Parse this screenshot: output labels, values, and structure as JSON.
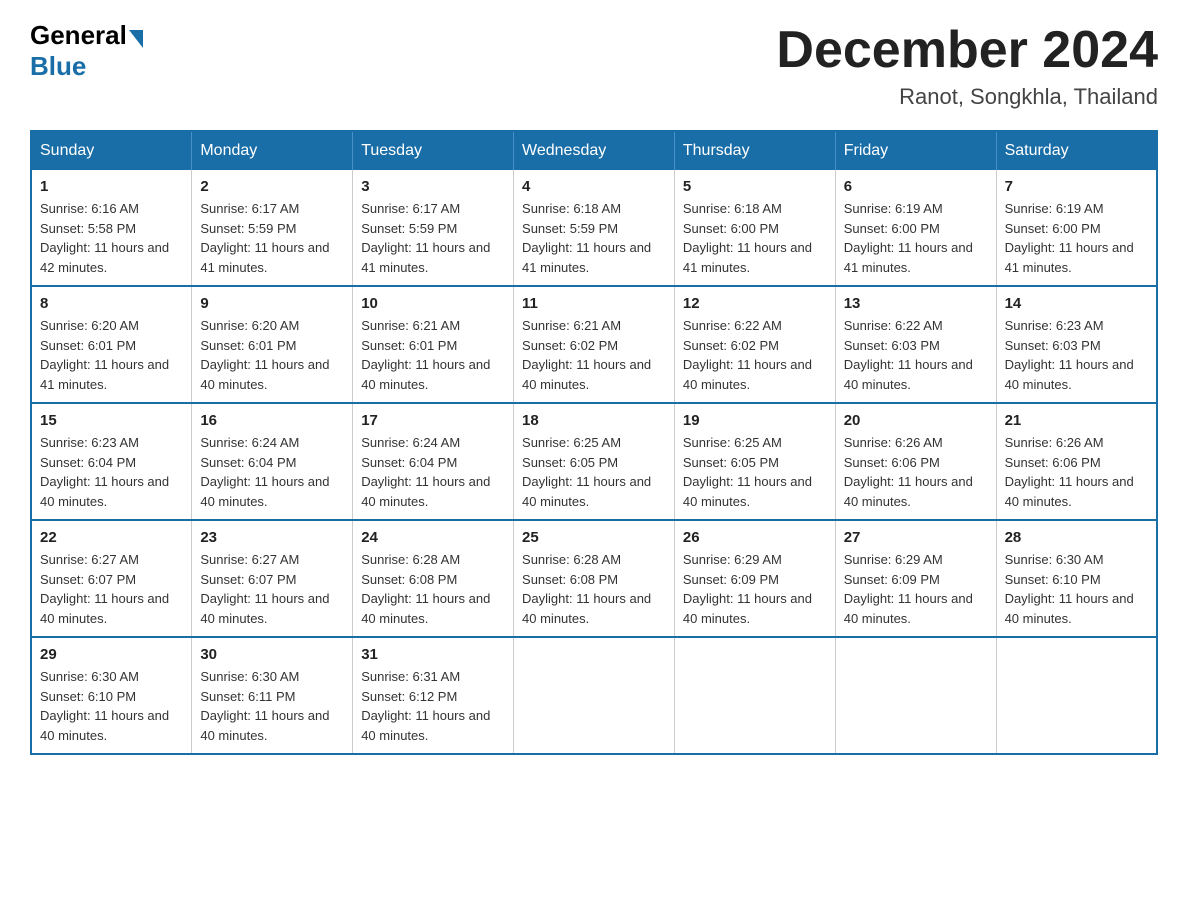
{
  "header": {
    "logo_general": "General",
    "logo_blue": "Blue",
    "month_title": "December 2024",
    "location": "Ranot, Songkhla, Thailand"
  },
  "calendar": {
    "days_of_week": [
      "Sunday",
      "Monday",
      "Tuesday",
      "Wednesday",
      "Thursday",
      "Friday",
      "Saturday"
    ],
    "weeks": [
      [
        {
          "day": "1",
          "sunrise": "6:16 AM",
          "sunset": "5:58 PM",
          "daylight": "11 hours and 42 minutes."
        },
        {
          "day": "2",
          "sunrise": "6:17 AM",
          "sunset": "5:59 PM",
          "daylight": "11 hours and 41 minutes."
        },
        {
          "day": "3",
          "sunrise": "6:17 AM",
          "sunset": "5:59 PM",
          "daylight": "11 hours and 41 minutes."
        },
        {
          "day": "4",
          "sunrise": "6:18 AM",
          "sunset": "5:59 PM",
          "daylight": "11 hours and 41 minutes."
        },
        {
          "day": "5",
          "sunrise": "6:18 AM",
          "sunset": "6:00 PM",
          "daylight": "11 hours and 41 minutes."
        },
        {
          "day": "6",
          "sunrise": "6:19 AM",
          "sunset": "6:00 PM",
          "daylight": "11 hours and 41 minutes."
        },
        {
          "day": "7",
          "sunrise": "6:19 AM",
          "sunset": "6:00 PM",
          "daylight": "11 hours and 41 minutes."
        }
      ],
      [
        {
          "day": "8",
          "sunrise": "6:20 AM",
          "sunset": "6:01 PM",
          "daylight": "11 hours and 41 minutes."
        },
        {
          "day": "9",
          "sunrise": "6:20 AM",
          "sunset": "6:01 PM",
          "daylight": "11 hours and 40 minutes."
        },
        {
          "day": "10",
          "sunrise": "6:21 AM",
          "sunset": "6:01 PM",
          "daylight": "11 hours and 40 minutes."
        },
        {
          "day": "11",
          "sunrise": "6:21 AM",
          "sunset": "6:02 PM",
          "daylight": "11 hours and 40 minutes."
        },
        {
          "day": "12",
          "sunrise": "6:22 AM",
          "sunset": "6:02 PM",
          "daylight": "11 hours and 40 minutes."
        },
        {
          "day": "13",
          "sunrise": "6:22 AM",
          "sunset": "6:03 PM",
          "daylight": "11 hours and 40 minutes."
        },
        {
          "day": "14",
          "sunrise": "6:23 AM",
          "sunset": "6:03 PM",
          "daylight": "11 hours and 40 minutes."
        }
      ],
      [
        {
          "day": "15",
          "sunrise": "6:23 AM",
          "sunset": "6:04 PM",
          "daylight": "11 hours and 40 minutes."
        },
        {
          "day": "16",
          "sunrise": "6:24 AM",
          "sunset": "6:04 PM",
          "daylight": "11 hours and 40 minutes."
        },
        {
          "day": "17",
          "sunrise": "6:24 AM",
          "sunset": "6:04 PM",
          "daylight": "11 hours and 40 minutes."
        },
        {
          "day": "18",
          "sunrise": "6:25 AM",
          "sunset": "6:05 PM",
          "daylight": "11 hours and 40 minutes."
        },
        {
          "day": "19",
          "sunrise": "6:25 AM",
          "sunset": "6:05 PM",
          "daylight": "11 hours and 40 minutes."
        },
        {
          "day": "20",
          "sunrise": "6:26 AM",
          "sunset": "6:06 PM",
          "daylight": "11 hours and 40 minutes."
        },
        {
          "day": "21",
          "sunrise": "6:26 AM",
          "sunset": "6:06 PM",
          "daylight": "11 hours and 40 minutes."
        }
      ],
      [
        {
          "day": "22",
          "sunrise": "6:27 AM",
          "sunset": "6:07 PM",
          "daylight": "11 hours and 40 minutes."
        },
        {
          "day": "23",
          "sunrise": "6:27 AM",
          "sunset": "6:07 PM",
          "daylight": "11 hours and 40 minutes."
        },
        {
          "day": "24",
          "sunrise": "6:28 AM",
          "sunset": "6:08 PM",
          "daylight": "11 hours and 40 minutes."
        },
        {
          "day": "25",
          "sunrise": "6:28 AM",
          "sunset": "6:08 PM",
          "daylight": "11 hours and 40 minutes."
        },
        {
          "day": "26",
          "sunrise": "6:29 AM",
          "sunset": "6:09 PM",
          "daylight": "11 hours and 40 minutes."
        },
        {
          "day": "27",
          "sunrise": "6:29 AM",
          "sunset": "6:09 PM",
          "daylight": "11 hours and 40 minutes."
        },
        {
          "day": "28",
          "sunrise": "6:30 AM",
          "sunset": "6:10 PM",
          "daylight": "11 hours and 40 minutes."
        }
      ],
      [
        {
          "day": "29",
          "sunrise": "6:30 AM",
          "sunset": "6:10 PM",
          "daylight": "11 hours and 40 minutes."
        },
        {
          "day": "30",
          "sunrise": "6:30 AM",
          "sunset": "6:11 PM",
          "daylight": "11 hours and 40 minutes."
        },
        {
          "day": "31",
          "sunrise": "6:31 AM",
          "sunset": "6:12 PM",
          "daylight": "11 hours and 40 minutes."
        },
        null,
        null,
        null,
        null
      ]
    ]
  }
}
